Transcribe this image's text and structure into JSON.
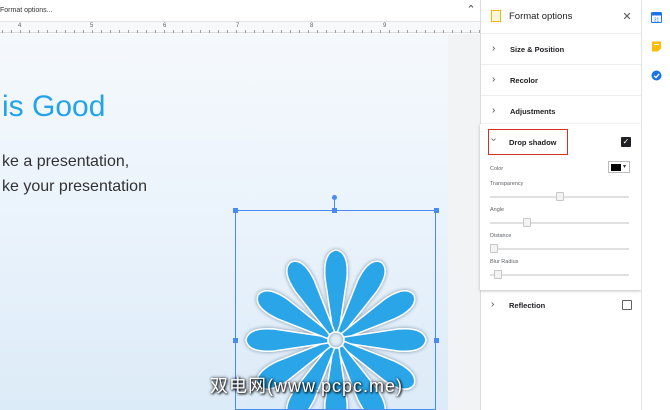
{
  "topbar": {
    "menu_text": "Format options...",
    "collapse_icon": "chevron-up-icon"
  },
  "ruler": {
    "labels": [
      "4",
      "5",
      "6",
      "7",
      "8",
      "9"
    ]
  },
  "slide": {
    "title": "is Good",
    "line1": "ke a presentation,",
    "line2": "ke your presentation",
    "shape_color": "#2aa6e8"
  },
  "watermark": "双电网(www.pcpc.me)",
  "panel": {
    "title": "Format options",
    "close_icon": "close-icon",
    "sections": [
      {
        "label": "Size & Position"
      },
      {
        "label": "Recolor"
      },
      {
        "label": "Adjustments"
      }
    ],
    "drop_shadow": {
      "label": "Drop shadow",
      "checked": true,
      "color_label": "Color",
      "color_value": "#000000",
      "sliders": [
        {
          "label": "Transparency",
          "value": 0.5
        },
        {
          "label": "Angle",
          "value": 0.25
        },
        {
          "label": "Distance",
          "value": 0.0
        },
        {
          "label": "Blur Radius",
          "value": 0.03
        }
      ]
    },
    "reflection": {
      "label": "Reflection",
      "checked": false
    }
  },
  "sidebar": {
    "icons": [
      "calendar-icon",
      "keep-icon",
      "tasks-icon"
    ]
  },
  "colors": {
    "accent": "#4a8af4",
    "highlight": "#d93025",
    "title_blue": "#24a4e8"
  }
}
